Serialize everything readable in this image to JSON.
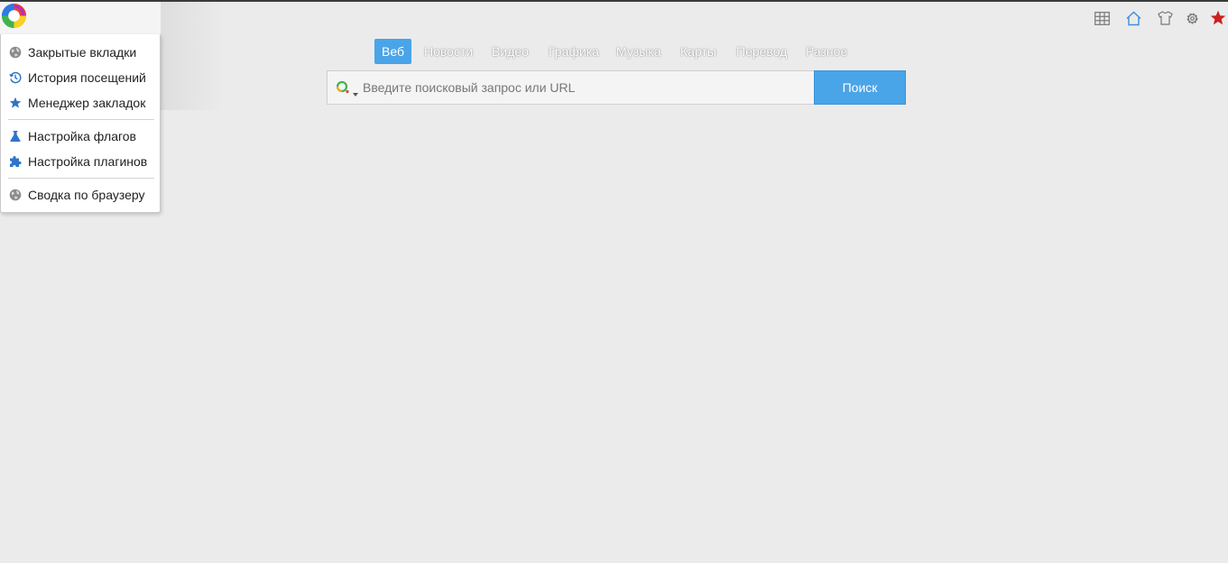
{
  "menu": {
    "items": [
      {
        "label": "Закрытые вкладки",
        "icon": "globe-icon"
      },
      {
        "label": "История посещений",
        "icon": "history-clock-icon"
      },
      {
        "label": "Менеджер закладок",
        "icon": "star-icon"
      },
      {
        "label": "Настройка флагов",
        "icon": "flask-icon"
      },
      {
        "label": "Настройка плагинов",
        "icon": "puzzle-icon"
      },
      {
        "label": "Сводка по браузеру",
        "icon": "globe-icon"
      }
    ]
  },
  "toolbar": {
    "icons": [
      "grid-icon",
      "home-icon",
      "shirt-icon",
      "gear-icon",
      "star-icon"
    ]
  },
  "tabs": {
    "items": [
      "Веб",
      "Новости",
      "Видео",
      "Графика",
      "Музыка",
      "Карты",
      "Перевод",
      "Разное"
    ],
    "active": "Веб"
  },
  "search": {
    "placeholder": "Введите поисковый запрос или URL",
    "value": "",
    "button_label": "Поиск"
  },
  "colors": {
    "accent": "#4aa4e8",
    "background": "#ebebeb",
    "bookmark_star": "#cc1f1f"
  }
}
